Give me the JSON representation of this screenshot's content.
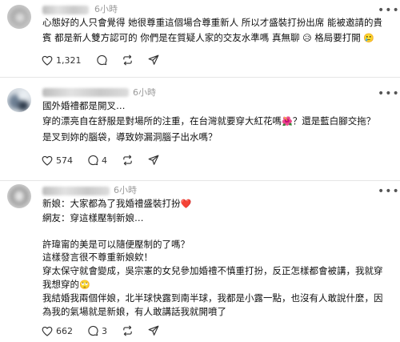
{
  "posts": [
    {
      "username": "yu___kun",
      "time": "6小時",
      "lines": [
        "心態好的人只會覺得 她很尊重這個場合尊重新人 所以才盛裝打扮出席 能被邀請的貴",
        "賓 都是新人雙方認可的 你們是在質疑人家的交友水準嗎 真無聊",
        " 格局要打開"
      ],
      "emoji_1": "😥",
      "emoji_2": "🥲",
      "like_count": "1,321"
    },
    {
      "username": "villiger_vipper_yud",
      "time": "6小時",
      "lines": [
        "國外婚禮都是開叉…",
        "穿的漂亮自在舒服是對場所的注重，在台灣就要穿大紅花嗎",
        "？還是藍白腳交拖？",
        "是叉到妳的腦袋，導致妳漏洞腦子出水嗎？"
      ],
      "emoji_1": "🌺",
      "like_count": "574",
      "comment_count": "4"
    },
    {
      "username": "sherry100891",
      "time": "6小時",
      "lines": [
        "新娘：大家都為了我婚禮盛裝打扮",
        "網友：穿這樣壓制新娘…",
        "",
        "許瑋甯的美是可以隨便壓制的了嗎？",
        "這樣發言很不尊重新娘欸！",
        "穿太保守就會變成，吳宗憲的女兒參加婚禮不慎重打扮，反正怎樣都會被講，我就穿",
        "我想穿的",
        "我結婚我兩個伴娘，北半球快露到南半球，我都是小露一點，也沒有人敢說什麼，因",
        "為我的氣場就是新娘，有人敢講話我就開噴了"
      ],
      "emoji_1": "❤️",
      "emoji_2": "🙄",
      "like_count": "662",
      "comment_count": "3"
    }
  ],
  "colors": {
    "heart_emoji": "#e0245e",
    "flower_emoji": "#d63a5a",
    "text": "#111111",
    "muted": "#9a9a9a"
  },
  "icons": [
    "more-icon",
    "heart-icon",
    "comment-icon",
    "repost-icon",
    "share-icon"
  ]
}
